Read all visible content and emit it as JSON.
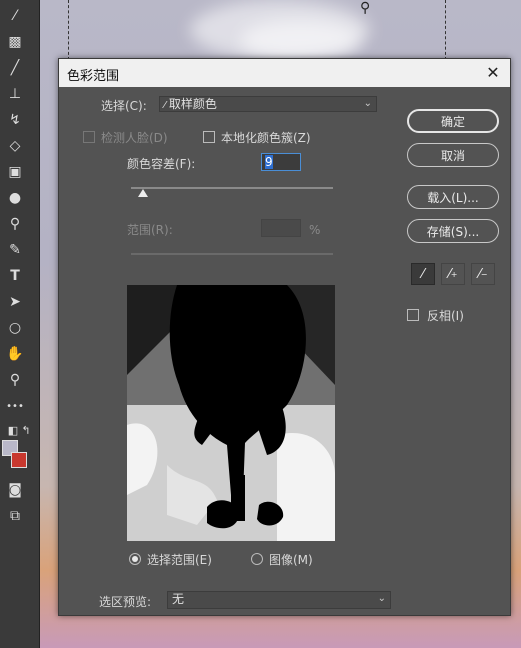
{
  "dialog": {
    "title": "色彩范围",
    "close_icon": "close-icon",
    "select_label": "选择(C):",
    "select_value": "取样颜色",
    "detect_faces_label": "检测人脸(D)",
    "localized_clusters_label": "本地化颜色簇(Z)",
    "fuzziness_label": "颜色容差(F):",
    "fuzziness_value": "9",
    "range_label": "范围(R):",
    "range_unit": "%",
    "fuzziness_level": 0.06,
    "buttons": {
      "ok": "确定",
      "cancel": "取消",
      "load": "载入(L)...",
      "save": "存储(S)..."
    },
    "invert_label": "反相(I)",
    "radio_selection": "选择范围(E)",
    "radio_image": "图像(M)",
    "preview_label": "选区预览:",
    "preview_value": "无"
  },
  "colors": {
    "dialog_bg": "#535353",
    "foreground_swatch": "#b9b8c8",
    "background_swatch": "#c8382e"
  },
  "toolbar": {
    "icons": [
      "eyedropper-icon",
      "healing-brush-icon",
      "brush-icon",
      "clone-stamp-icon",
      "history-brush-icon",
      "eraser-icon",
      "gradient-icon",
      "blur-icon",
      "dodge-icon",
      "pen-icon",
      "type-icon",
      "path-select-icon",
      "ellipse-icon",
      "hand-icon",
      "zoom-icon",
      "more-icon"
    ],
    "type_glyph": "T",
    "more_glyph": "•••"
  }
}
